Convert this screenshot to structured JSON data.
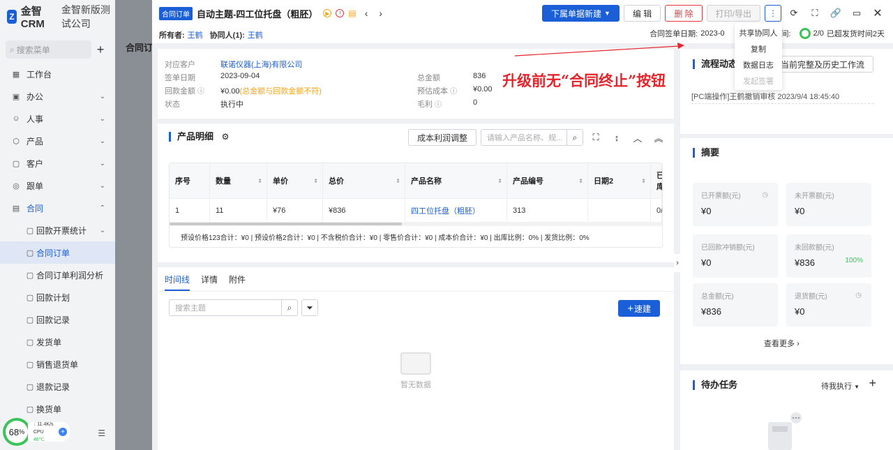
{
  "app": {
    "name": "金智CRM",
    "company": "金智新版测试公司"
  },
  "sidebar": {
    "search_placeholder": "搜索菜单",
    "items": [
      {
        "label": "工作台",
        "icon": "grid-icon"
      },
      {
        "label": "办公",
        "icon": "briefcase-icon",
        "chevron": "⌄"
      },
      {
        "label": "人事",
        "icon": "person-icon",
        "chevron": "⌄"
      },
      {
        "label": "产品",
        "icon": "cube-icon",
        "chevron": "⌄"
      },
      {
        "label": "客户",
        "icon": "customer-icon",
        "chevron": "⌄"
      },
      {
        "label": "跟单",
        "icon": "target-icon",
        "chevron": "⌄"
      },
      {
        "label": "合同",
        "icon": "document-icon",
        "chevron": "⌃"
      }
    ],
    "sub_items": [
      {
        "label": "回款开票统计",
        "chevron": "⌄"
      },
      {
        "label": "合同订单"
      },
      {
        "label": "合同订单利润分析"
      },
      {
        "label": "回款计划"
      },
      {
        "label": "回款记录"
      },
      {
        "label": "发货单"
      },
      {
        "label": "销售退货单"
      },
      {
        "label": "退款记录"
      },
      {
        "label": "换货单"
      }
    ]
  },
  "background": {
    "page_title": "合同订",
    "bottom_fragment": "全"
  },
  "perf": {
    "percent": "68",
    "unit": "%",
    "net": "11.4K/s",
    "cpu_label": "CPU",
    "cpu_temp": "46℃"
  },
  "drawer": {
    "tag": "合同订单",
    "title": "自动主题-四工位托盘（粗胚）",
    "prev": "‹",
    "next": "›",
    "actions": {
      "new_label": "下属单据新建",
      "edit_label": "编 辑",
      "delete_label": "删 除",
      "print_label": "打印/导出",
      "more_label": "⋮"
    },
    "owner_label": "所有者:",
    "owner": "王鹤",
    "collab_label": "协同人(1):",
    "collab": "王鹤",
    "sign_date_label": "合同签单日期:",
    "sign_date_partial": "2023-0",
    "ship_label_partial": "时间:",
    "ship_count": "2/0",
    "ship_status": "已超发货时间2天",
    "menu": [
      "共享协同人",
      "复制",
      "数据日志",
      "发起签署"
    ]
  },
  "info": {
    "customer_label": "对应客户",
    "customer": "联诺仪器(上海)有限公司",
    "sign_label": "签单日期",
    "sign": "2023-09-04",
    "paid_label": "回款金额",
    "paid": "¥0.00",
    "paid_note": "(总金额与回款金额不符)",
    "status_label": "状态",
    "status": "执行中",
    "total_label": "总金额",
    "total": "836",
    "cost_label": "预估成本",
    "cost": "¥0.00",
    "margin_label": "毛利",
    "margin": "0"
  },
  "product": {
    "title": "产品明细",
    "adjust_label": "成本利润调整",
    "search_placeholder": "请输入产品名称、规...",
    "columns": [
      "序号",
      "数量",
      "单价",
      "总价",
      "产品名称",
      "产品编号",
      "日期2",
      "已库"
    ],
    "rows": [
      [
        "1",
        "11",
        "¥76",
        "¥836",
        "四工位托盘（粗胚）",
        "313",
        "",
        "0/"
      ]
    ],
    "totals": "预设价格123合计：¥0 |   预设价格2合计：¥0 |   不含税价合计：¥0 |   零售价合计：¥0 |   成本价合计：¥0 |   出库比例：0% |   发货比例：0%"
  },
  "timeline": {
    "tabs": [
      "时间线",
      "详情",
      "附件"
    ],
    "search_placeholder": "搜索主题",
    "quick_label": "速建",
    "empty_label": "暂无数据"
  },
  "flow": {
    "title": "流程动态",
    "history_btn": "当前完整及历史工作流",
    "entry": "[PC端操作]王鹤撤销审核 2023/9/4 18:45:40"
  },
  "summary": {
    "title": "摘要",
    "metrics": [
      {
        "label": "已开票额(元)",
        "value": "¥0",
        "clock": true
      },
      {
        "label": "未开票额(元)",
        "value": "¥0"
      },
      {
        "label": "已回款冲销额(元)",
        "value": "¥0"
      },
      {
        "label": "未回款额(元)",
        "value": "¥836",
        "pct": "100%"
      },
      {
        "label": "总金额(元)",
        "value": "¥836"
      },
      {
        "label": "退货额(元)",
        "value": "¥0",
        "clock": true
      }
    ],
    "more": "查看更多"
  },
  "todo": {
    "title": "待办任务",
    "filter": "待我执行",
    "add": "+"
  },
  "annotation": "升级前无“合同终止”按钮"
}
